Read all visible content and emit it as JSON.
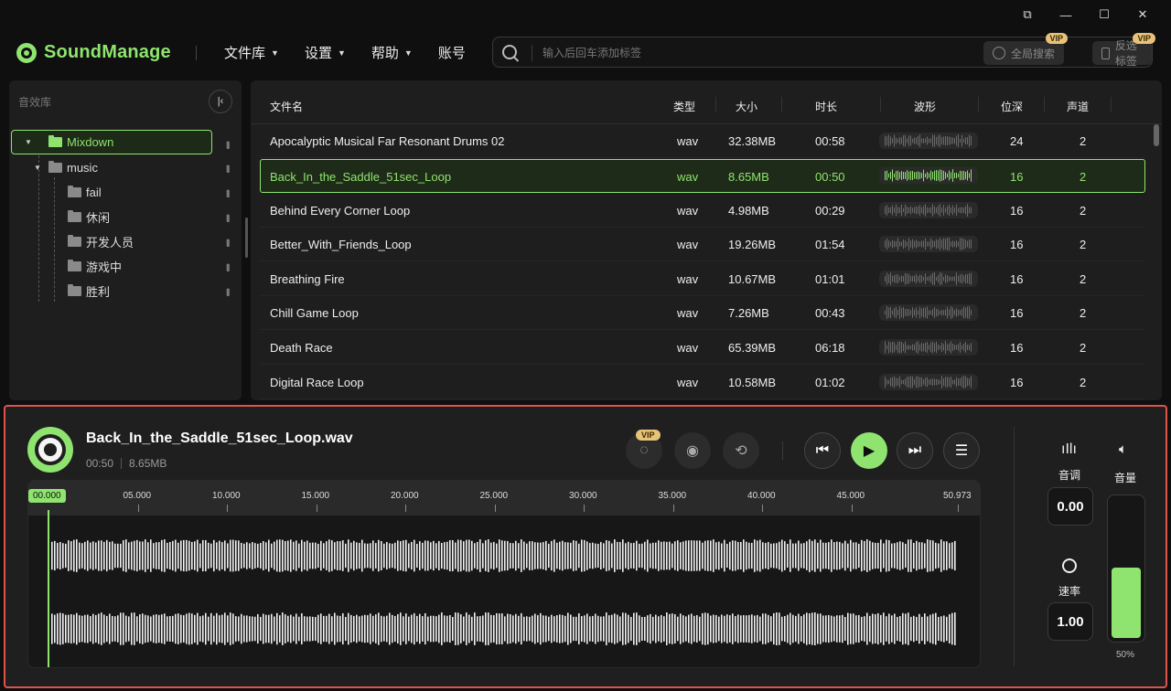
{
  "app": {
    "name": "SoundManage",
    "accent": "#8fe46f",
    "alert_border": "#e0534d"
  },
  "window_controls": [
    "restore-icon",
    "minimize-icon",
    "maximize-icon",
    "close-icon"
  ],
  "nav": {
    "library": "文件库",
    "settings": "设置",
    "help": "帮助",
    "account": "账号"
  },
  "search": {
    "placeholder": "输入后回车添加标签",
    "global_search": "全局搜索",
    "invert_tags": "反选标签",
    "vip": "VIP"
  },
  "sidebar": {
    "title": "音效库",
    "tree": [
      {
        "label": "Mixdown",
        "level": 0,
        "expanded": true,
        "selected": true
      },
      {
        "label": "music",
        "level": 1,
        "expanded": true
      },
      {
        "label": "fail",
        "level": 2
      },
      {
        "label": "休闲",
        "level": 2
      },
      {
        "label": "开发人员",
        "level": 2
      },
      {
        "label": "游戏中",
        "level": 2
      },
      {
        "label": "胜利",
        "level": 2
      }
    ]
  },
  "table": {
    "columns": [
      "文件名",
      "类型",
      "大小",
      "时长",
      "波形",
      "位深",
      "声道"
    ],
    "rows": [
      {
        "name": "Apocalyptic Musical Far Resonant Drums 02",
        "type": "wav",
        "size": "32.38MB",
        "duration": "00:58",
        "bit_depth": "24",
        "channels": "2"
      },
      {
        "name": "Back_In_the_Saddle_51sec_Loop",
        "type": "wav",
        "size": "8.65MB",
        "duration": "00:50",
        "bit_depth": "16",
        "channels": "2",
        "selected": true
      },
      {
        "name": "Behind Every Corner Loop",
        "type": "wav",
        "size": "4.98MB",
        "duration": "00:29",
        "bit_depth": "16",
        "channels": "2"
      },
      {
        "name": "Better_With_Friends_Loop",
        "type": "wav",
        "size": "19.26MB",
        "duration": "01:54",
        "bit_depth": "16",
        "channels": "2"
      },
      {
        "name": "Breathing Fire",
        "type": "wav",
        "size": "10.67MB",
        "duration": "01:01",
        "bit_depth": "16",
        "channels": "2"
      },
      {
        "name": "Chill Game Loop",
        "type": "wav",
        "size": "7.26MB",
        "duration": "00:43",
        "bit_depth": "16",
        "channels": "2"
      },
      {
        "name": "Death Race",
        "type": "wav",
        "size": "65.39MB",
        "duration": "06:18",
        "bit_depth": "16",
        "channels": "2"
      },
      {
        "name": "Digital Race Loop",
        "type": "wav",
        "size": "10.58MB",
        "duration": "01:02",
        "bit_depth": "16",
        "channels": "2"
      }
    ]
  },
  "player": {
    "title": "Back_In_the_Saddle_51sec_Loop.wav",
    "duration": "00:50",
    "size": "8.65MB",
    "vip": "VIP",
    "current_time": "00.000",
    "ticks": [
      "05.000",
      "10.000",
      "15.000",
      "20.000",
      "25.000",
      "30.000",
      "35.000",
      "40.000",
      "45.000",
      "50.973"
    ],
    "pitch_label": "音调",
    "pitch_value": "0.00",
    "rate_label": "速率",
    "rate_value": "1.00",
    "volume_label": "音量",
    "volume_percent": "50%",
    "volume_level": 0.5
  }
}
